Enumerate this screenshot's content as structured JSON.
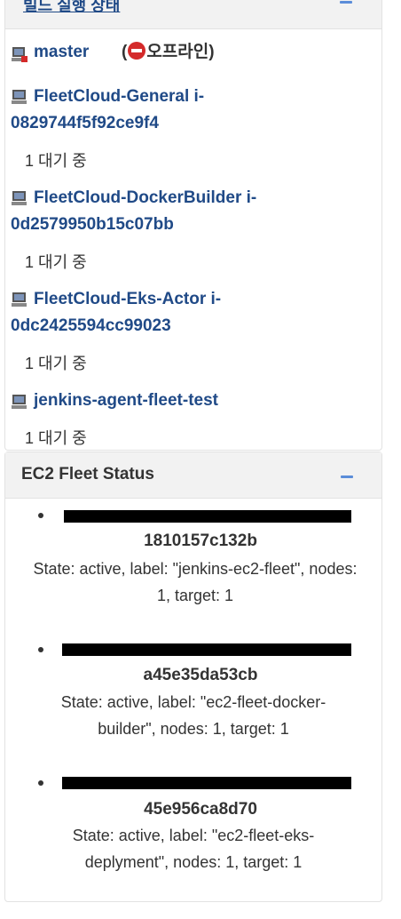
{
  "executor_panel": {
    "title": "빌드 실행 상태",
    "nodes": [
      {
        "name": "master",
        "status": "(",
        "status_text": "오프라인)",
        "idle": ""
      },
      {
        "name_line1": "FleetCloud-General i-",
        "name_line2": "0829744f5f92ce9f4",
        "idle": "1 대기 중"
      },
      {
        "name_line1": "FleetCloud-DockerBuilder i-",
        "name_line2": "0d2579950b15c07bb",
        "idle": "1 대기 중"
      },
      {
        "name_line1": "FleetCloud-Eks-Actor i-",
        "name_line2": "0dc2425594cc99023",
        "idle": "1 대기 중"
      },
      {
        "name": "jenkins-agent-fleet-test",
        "idle": "1 대기 중"
      }
    ]
  },
  "fleet_panel": {
    "title": "EC2 Fleet Status",
    "fleets": [
      {
        "id_suffix": "1810157c132b",
        "state_line1": "State: active, label: \"jenkins-ec2-fleet\", nodes:",
        "state_line2": "1, target: 1"
      },
      {
        "id_suffix": "a45e35da53cb",
        "state_line1": "State: active, label: \"ec2-fleet-docker-",
        "state_line2": "builder\", nodes: 1, target: 1"
      },
      {
        "id_suffix": "45e956ca8d70",
        "state_line1": "State: active, label: \"ec2-fleet-eks-",
        "state_line2": "deplyment\", nodes: 1, target: 1"
      }
    ]
  },
  "colors": {
    "link": "#204a87",
    "offline_icon": "#d42a2a",
    "collapse": "#5b8dd9"
  },
  "icons": [
    "computer-icon",
    "computer-offline-icon",
    "stop-icon",
    "collapse-icon"
  ]
}
